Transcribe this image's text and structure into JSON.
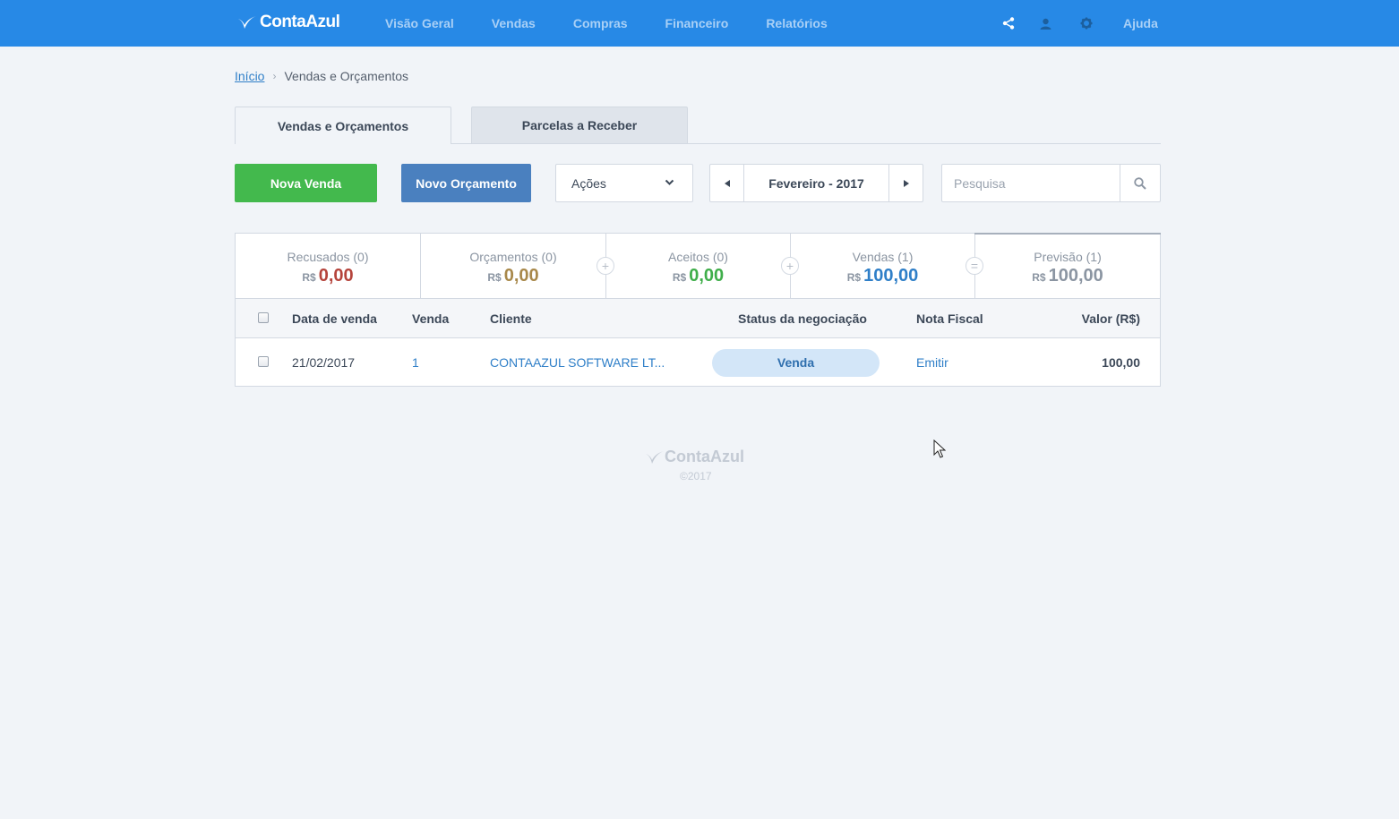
{
  "header": {
    "logo": "ContaAzul",
    "nav": [
      "Visão Geral",
      "Vendas",
      "Compras",
      "Financeiro",
      "Relatórios"
    ],
    "icons": [
      "share-icon",
      "user-icon",
      "gear-icon"
    ],
    "help": "Ajuda",
    "colors": {
      "bar": "#2789e6"
    }
  },
  "breadcrumb": {
    "home": "Início",
    "current": "Vendas e Orçamentos"
  },
  "tabs": [
    {
      "label": "Vendas e Orçamentos",
      "active": true
    },
    {
      "label": "Parcelas a Receber",
      "active": false
    }
  ],
  "toolbar": {
    "new_sale": "Nova Venda",
    "new_quote": "Novo Orçamento",
    "actions": "Ações",
    "period": "Fevereiro - 2017",
    "search_placeholder": "Pesquisa"
  },
  "summary": [
    {
      "label": "Recusados (0)",
      "currency": "R$",
      "value": "0,00",
      "color": "#b5443c"
    },
    {
      "label": "Orçamentos (0)",
      "currency": "R$",
      "value": "0,00",
      "color": "#a8884a"
    },
    {
      "label": "Aceitos (0)",
      "currency": "R$",
      "value": "0,00",
      "color": "#3fae4a"
    },
    {
      "label": "Vendas (1)",
      "currency": "R$",
      "value": "100,00",
      "color": "#2f7fc8"
    },
    {
      "label": "Previsão (1)",
      "currency": "R$",
      "value": "100,00",
      "color": "#8b95a2"
    }
  ],
  "operators": [
    "+",
    "+",
    "="
  ],
  "table": {
    "columns": [
      "Data de venda",
      "Venda",
      "Cliente",
      "Status da negociação",
      "Nota Fiscal",
      "Valor (R$)"
    ],
    "rows": [
      {
        "date": "21/02/2017",
        "number": "1",
        "client": "CONTAAZUL SOFTWARE LT...",
        "status": "Venda",
        "invoice": "Emitir",
        "value": "100,00"
      }
    ]
  },
  "footer": {
    "logo": "ContaAzul",
    "copyright": "©2017"
  }
}
